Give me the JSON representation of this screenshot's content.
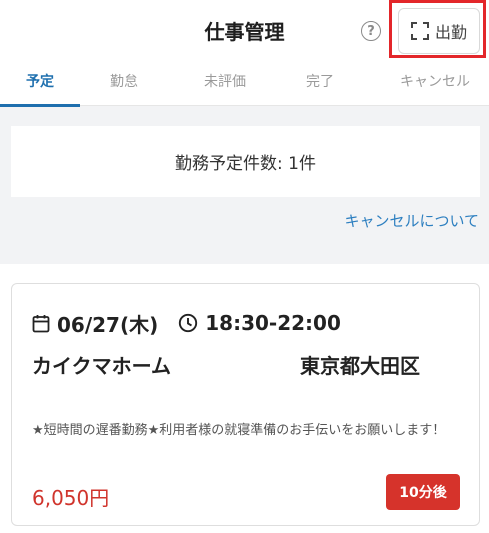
{
  "header": {
    "title": "仕事管理",
    "help_icon": "question-circle-icon",
    "clock_in_label": "出勤",
    "clock_in_icon": "scan-frame-icon",
    "highlight_color": "#e3262a"
  },
  "tabs": [
    {
      "label": "予定",
      "active": true
    },
    {
      "label": "勤怠",
      "active": false
    },
    {
      "label": "未評価",
      "active": false
    },
    {
      "label": "完了",
      "active": false
    },
    {
      "label": "キャンセル",
      "active": false
    }
  ],
  "summary": {
    "text": "勤務予定件数: 1件"
  },
  "cancel_link": "キャンセルについて",
  "job": {
    "date": "06/27(木)",
    "time": "18:30-22:00",
    "company": "カイクマホーム",
    "location": "東京都大田区",
    "description": "★短時間の遅番勤務★利用者様の就寝準備のお手伝いをお願いします！",
    "wage": "6,050円",
    "start_badge": "10分後",
    "accent_color": "#d6332b"
  }
}
